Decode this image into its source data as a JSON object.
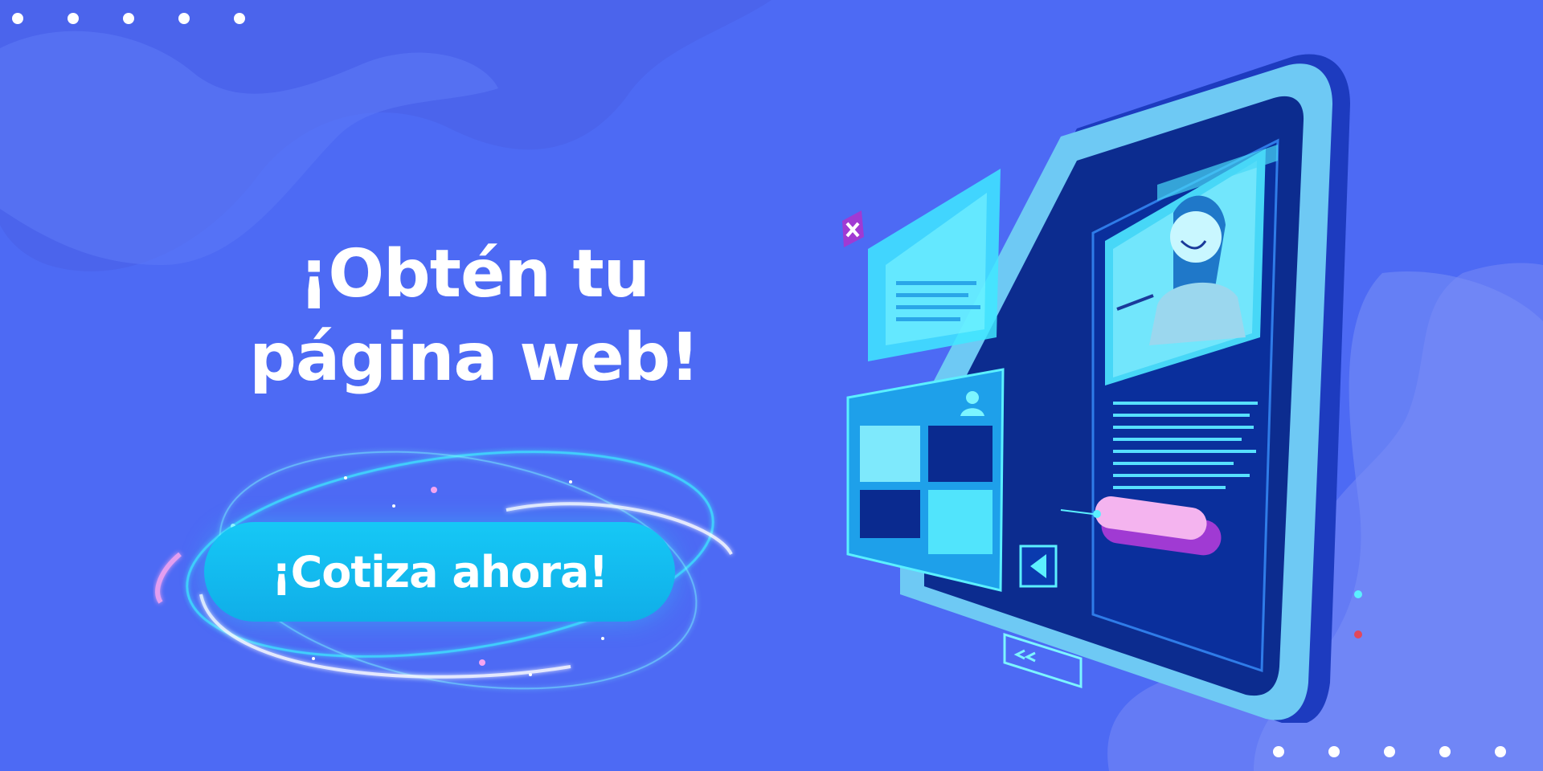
{
  "headline": {
    "line1": "¡Obtén tu",
    "line2": "página web!"
  },
  "cta": {
    "label": "¡Cotiza ahora!"
  },
  "colors": {
    "background": "#4d6af4",
    "accent": "#16c8f6",
    "text": "#ffffff",
    "cyan_glow": "#39f3ff",
    "pink": "#f4a4f0",
    "purple": "#9b3bd3"
  },
  "icons": [
    "close-icon",
    "user-icon",
    "play-left-icon",
    "double-chevron-left-icon",
    "pencil-icon"
  ]
}
